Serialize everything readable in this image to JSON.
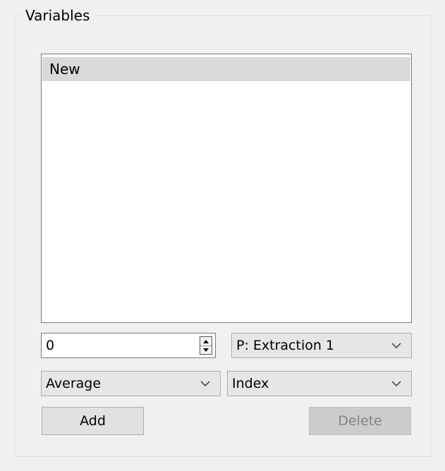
{
  "groupbox": {
    "title": "Variables"
  },
  "list": {
    "items": [
      "New"
    ],
    "selected_index": 0
  },
  "spinbox": {
    "value": "0"
  },
  "combos": {
    "extraction": "P: Extraction 1",
    "average": "Average",
    "index": "Index"
  },
  "buttons": {
    "add": "Add",
    "delete": "Delete"
  },
  "colors": {
    "background": "#f0f0f0",
    "selected_item": "#d9d9d9",
    "disabled_text": "#838383"
  }
}
